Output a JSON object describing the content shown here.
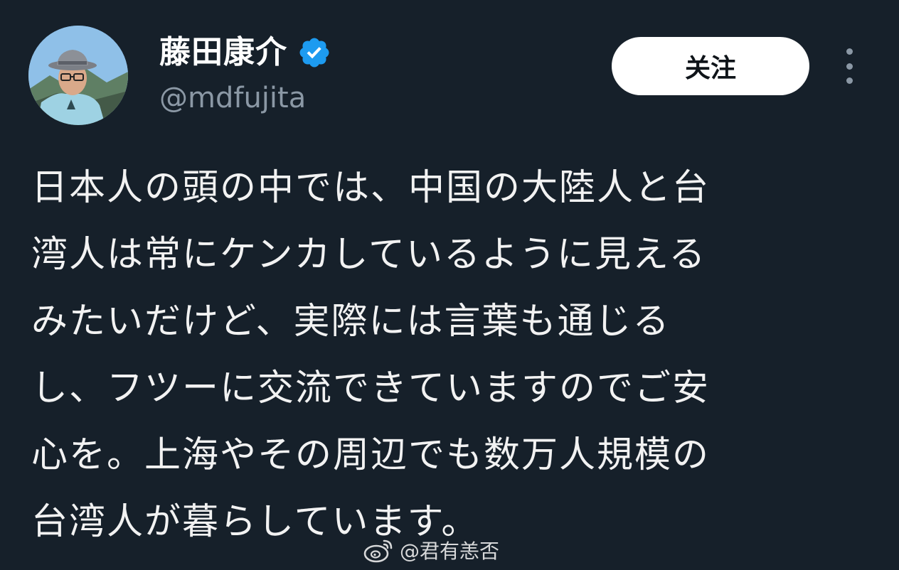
{
  "tweet": {
    "display_name": "藤田康介",
    "handle": "@mdfujita",
    "follow_label": "关注",
    "body_lines": [
      "日本人の頭の中では、中国の大陸人と台",
      "湾人は常にケンカしているように見える",
      "みたいだけど、実際には言葉も通じる",
      "し、フツーに交流できていますのでご安",
      "心を。上海やその周辺でも数万人規模の",
      "台湾人が暮らしています。"
    ]
  },
  "watermark": {
    "text": "@君有恙否"
  },
  "icons": {
    "verified": "verified-badge-icon",
    "more": "more-options-icon",
    "watermark": "weibo-logo-icon"
  },
  "colors": {
    "background": "#16202a",
    "text": "#ffffff",
    "handle": "#8b98a5",
    "verified": "#1d9bf0",
    "button_bg": "#ffffff",
    "button_text": "#0f1419"
  }
}
